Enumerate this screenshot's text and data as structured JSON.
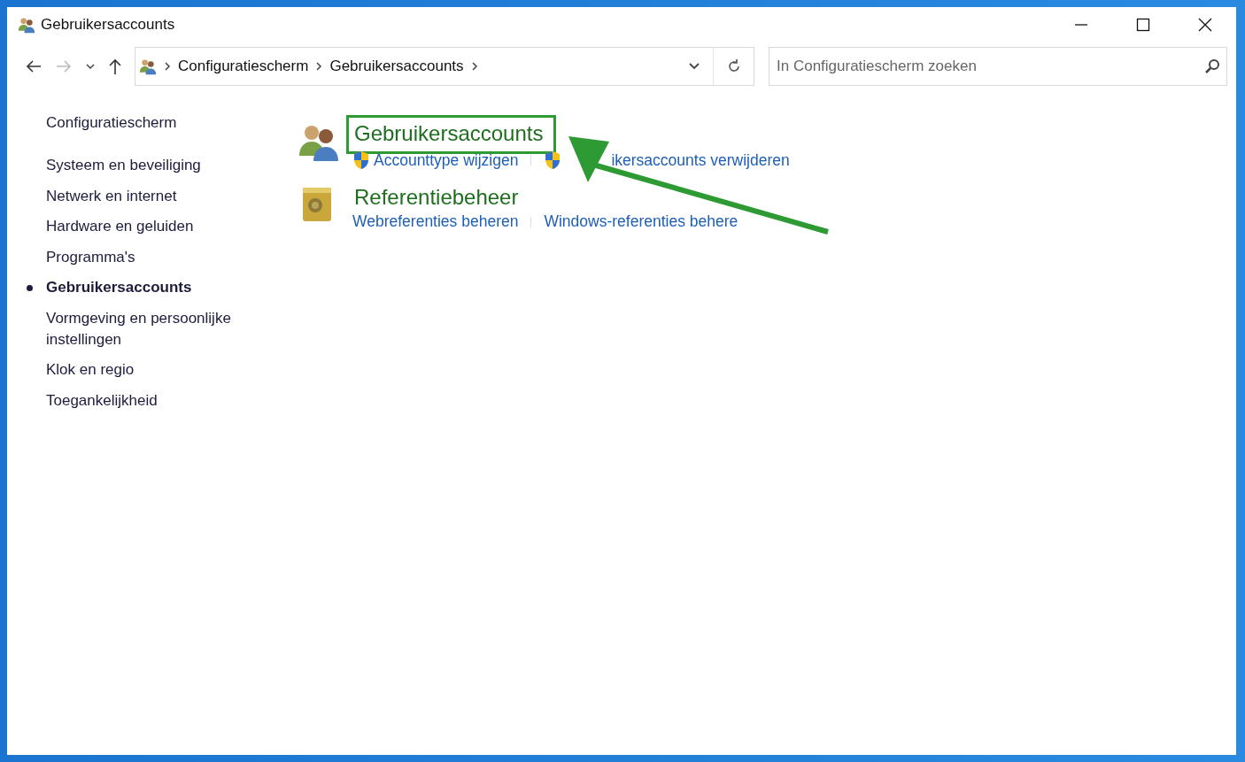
{
  "window": {
    "title": "Gebruikersaccounts"
  },
  "address_bar": {
    "breadcrumbs": [
      "Configuratiescherm",
      "Gebruikersaccounts"
    ]
  },
  "search": {
    "placeholder": "In Configuratiescherm zoeken"
  },
  "sidebar": {
    "home": "Configuratiescherm",
    "items": [
      {
        "label": "Systeem en beveiliging",
        "selected": false
      },
      {
        "label": "Netwerk en internet",
        "selected": false
      },
      {
        "label": "Hardware en geluiden",
        "selected": false
      },
      {
        "label": "Programma's",
        "selected": false
      },
      {
        "label": "Gebruikersaccounts",
        "selected": true
      },
      {
        "label": "Vormgeving en persoonlijke instellingen",
        "selected": false
      },
      {
        "label": "Klok en regio",
        "selected": false
      },
      {
        "label": "Toegankelijkheid",
        "selected": false
      }
    ]
  },
  "categories": [
    {
      "kind": "users",
      "title": "Gebruikersaccounts",
      "links": [
        {
          "label": "Accounttype wijzigen",
          "shield": true
        },
        {
          "label": "ikersaccounts verwijderen",
          "shield": true
        }
      ]
    },
    {
      "kind": "vault",
      "title": "Referentiebeheer",
      "links": [
        {
          "label": "Webreferenties beheren",
          "shield": false
        },
        {
          "label": "Windows-referenties behere",
          "shield": false
        }
      ]
    }
  ],
  "annotation": {
    "highlight_box": true,
    "arrow": true
  }
}
